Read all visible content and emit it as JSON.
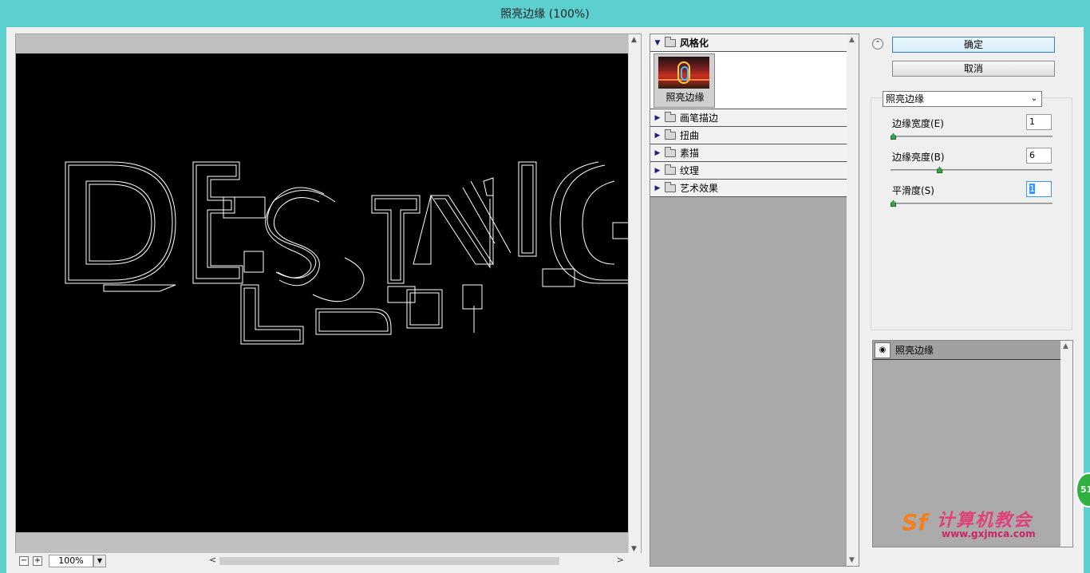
{
  "window": {
    "title": "照亮边缘 (100%)"
  },
  "preview": {
    "artwork_text": "DESINGLJIT",
    "zoom": "100%",
    "zoom_out": "−",
    "zoom_in": "+"
  },
  "gallery": {
    "categories": [
      {
        "label": "风格化",
        "expanded": true
      },
      {
        "label": "画笔描边",
        "expanded": false
      },
      {
        "label": "扭曲",
        "expanded": false
      },
      {
        "label": "素描",
        "expanded": false
      },
      {
        "label": "纹理",
        "expanded": false
      },
      {
        "label": "艺术效果",
        "expanded": false
      }
    ],
    "selected_thumb": "照亮边缘"
  },
  "buttons": {
    "ok": "确定",
    "cancel": "取消"
  },
  "filter_select": {
    "value": "照亮边缘"
  },
  "params": [
    {
      "label": "边缘宽度(E)",
      "value": "1",
      "fraction": 0.0
    },
    {
      "label": "边缘亮度(B)",
      "value": "6",
      "fraction": 0.3
    },
    {
      "label": "平滑度(S)",
      "value": "1",
      "fraction": 0.0
    }
  ],
  "layers": [
    {
      "label": "照亮边缘"
    }
  ],
  "watermark": {
    "text": "计算机教会",
    "url": "www.gxjmca.com",
    "logo": "Sf"
  },
  "badge": {
    "text": "51"
  },
  "colors": {
    "title_bar": "#5ccfcf",
    "canvas": "#000000",
    "knob": "#3aa04a",
    "ok_border": "#3c7fb1"
  }
}
